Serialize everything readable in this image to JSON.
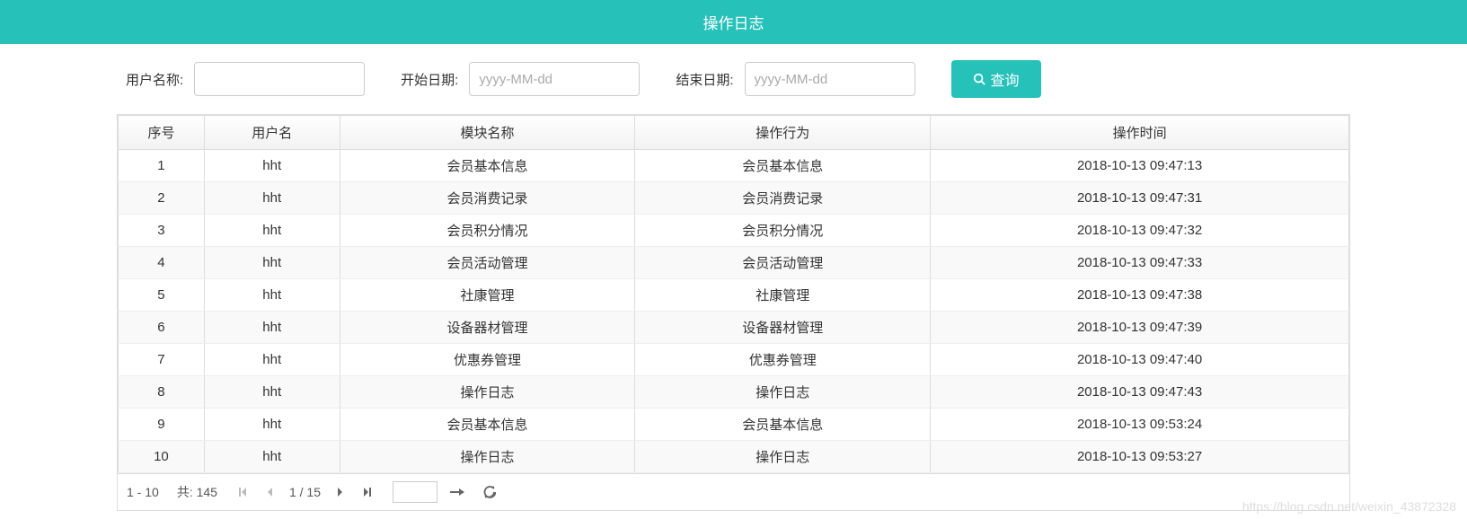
{
  "header": {
    "title": "操作日志"
  },
  "search": {
    "username_label": "用户名称:",
    "username_value": "",
    "start_label": "开始日期:",
    "start_placeholder": "yyyy-MM-dd",
    "start_value": "",
    "end_label": "结束日期:",
    "end_placeholder": "yyyy-MM-dd",
    "end_value": "",
    "button_label": "查询"
  },
  "table": {
    "headers": {
      "seq": "序号",
      "user": "用户名",
      "module": "模块名称",
      "action": "操作行为",
      "time": "操作时间"
    },
    "rows": [
      {
        "seq": "1",
        "user": "hht",
        "module": "会员基本信息",
        "action": "会员基本信息",
        "time": "2018-10-13 09:47:13"
      },
      {
        "seq": "2",
        "user": "hht",
        "module": "会员消费记录",
        "action": "会员消费记录",
        "time": "2018-10-13 09:47:31"
      },
      {
        "seq": "3",
        "user": "hht",
        "module": "会员积分情况",
        "action": "会员积分情况",
        "time": "2018-10-13 09:47:32"
      },
      {
        "seq": "4",
        "user": "hht",
        "module": "会员活动管理",
        "action": "会员活动管理",
        "time": "2018-10-13 09:47:33"
      },
      {
        "seq": "5",
        "user": "hht",
        "module": "社康管理",
        "action": "社康管理",
        "time": "2018-10-13 09:47:38"
      },
      {
        "seq": "6",
        "user": "hht",
        "module": "设备器材管理",
        "action": "设备器材管理",
        "time": "2018-10-13 09:47:39"
      },
      {
        "seq": "7",
        "user": "hht",
        "module": "优惠券管理",
        "action": "优惠券管理",
        "time": "2018-10-13 09:47:40"
      },
      {
        "seq": "8",
        "user": "hht",
        "module": "操作日志",
        "action": "操作日志",
        "time": "2018-10-13 09:47:43"
      },
      {
        "seq": "9",
        "user": "hht",
        "module": "会员基本信息",
        "action": "会员基本信息",
        "time": "2018-10-13 09:53:24"
      },
      {
        "seq": "10",
        "user": "hht",
        "module": "操作日志",
        "action": "操作日志",
        "time": "2018-10-13 09:53:27"
      }
    ]
  },
  "pager": {
    "range": "1 - 10",
    "total_label": "共: 145",
    "page_info": "1 / 15",
    "goto_value": ""
  },
  "watermark": "https://blog.csdn.net/weixin_43872328"
}
